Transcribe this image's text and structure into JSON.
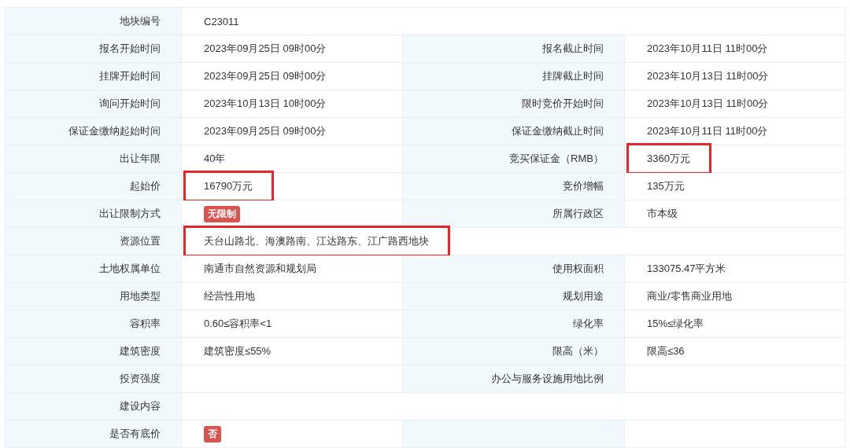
{
  "rows": [
    {
      "full_width": true,
      "cells": [
        {
          "label": "地块编号",
          "value": "C23011",
          "kind": "text"
        }
      ]
    },
    {
      "full_width": false,
      "cells": [
        {
          "label": "报名开始时间",
          "value": "2023年09月25日 09时00分",
          "kind": "text"
        },
        {
          "label": "报名截止时间",
          "value": "2023年10月11日 11时00分",
          "kind": "text"
        }
      ]
    },
    {
      "full_width": false,
      "cells": [
        {
          "label": "挂牌开始时间",
          "value": "2023年09月25日 09时00分",
          "kind": "text"
        },
        {
          "label": "挂牌截止时间",
          "value": "2023年10月13日 11时00分",
          "kind": "text"
        }
      ]
    },
    {
      "full_width": false,
      "cells": [
        {
          "label": "询问开始时间",
          "value": "2023年10月13日 10时00分",
          "kind": "text"
        },
        {
          "label": "限时竞价开始时间",
          "value": "2023年10月13日 11时00分",
          "kind": "text"
        }
      ]
    },
    {
      "full_width": false,
      "cells": [
        {
          "label": "保证金缴纳起始时间",
          "value": "2023年09月25日 09时00分",
          "kind": "text"
        },
        {
          "label": "保证金缴纳截止时间",
          "value": "2023年10月11日 11时00分",
          "kind": "text"
        }
      ]
    },
    {
      "full_width": false,
      "cells": [
        {
          "label": "出让年限",
          "value": "40年",
          "kind": "text"
        },
        {
          "label": "竞买保证金（RMB）",
          "value": "3360万元",
          "kind": "text",
          "highlighted": true
        }
      ]
    },
    {
      "full_width": false,
      "cells": [
        {
          "label": "起始价",
          "value": "16790万元",
          "kind": "text",
          "highlighted": true
        },
        {
          "label": "竞价增幅",
          "value": "135万元",
          "kind": "text"
        }
      ]
    },
    {
      "full_width": false,
      "cells": [
        {
          "label": "出让限制方式",
          "value": "无限制",
          "kind": "badge"
        },
        {
          "label": "所属行政区",
          "value": "市本级",
          "kind": "text"
        }
      ]
    },
    {
      "full_width": true,
      "cells": [
        {
          "label": "资源位置",
          "value": "天台山路北、海澳路南、江达路东、江广路西地块",
          "kind": "text",
          "highlighted": true
        }
      ]
    },
    {
      "full_width": false,
      "cells": [
        {
          "label": "土地权属单位",
          "value": "南通市自然资源和规划局",
          "kind": "text"
        },
        {
          "label": "使用权面积",
          "value": "133075.47平方米",
          "kind": "text"
        }
      ]
    },
    {
      "full_width": false,
      "cells": [
        {
          "label": "用地类型",
          "value": "经营性用地",
          "kind": "text"
        },
        {
          "label": "规划用途",
          "value": "商业/零售商业用地",
          "kind": "text"
        }
      ]
    },
    {
      "full_width": false,
      "cells": [
        {
          "label": "容积率",
          "value": "0.60≤容积率<1",
          "kind": "text"
        },
        {
          "label": "绿化率",
          "value": "15%≤绿化率",
          "kind": "text"
        }
      ]
    },
    {
      "full_width": false,
      "cells": [
        {
          "label": "建筑密度",
          "value": "建筑密度≤55%",
          "kind": "text"
        },
        {
          "label": "限高（米）",
          "value": "限高≤36",
          "kind": "text"
        }
      ]
    },
    {
      "full_width": false,
      "cells": [
        {
          "label": "投资强度"
        },
        {
          "label": "办公与服务设施用地比例"
        }
      ]
    },
    {
      "full_width": true,
      "cells": [
        {
          "label": "建设内容"
        }
      ]
    },
    {
      "full_width": false,
      "cells": [
        {
          "label": "是否有底价",
          "value": "否",
          "kind": "badge"
        }
      ]
    }
  ]
}
